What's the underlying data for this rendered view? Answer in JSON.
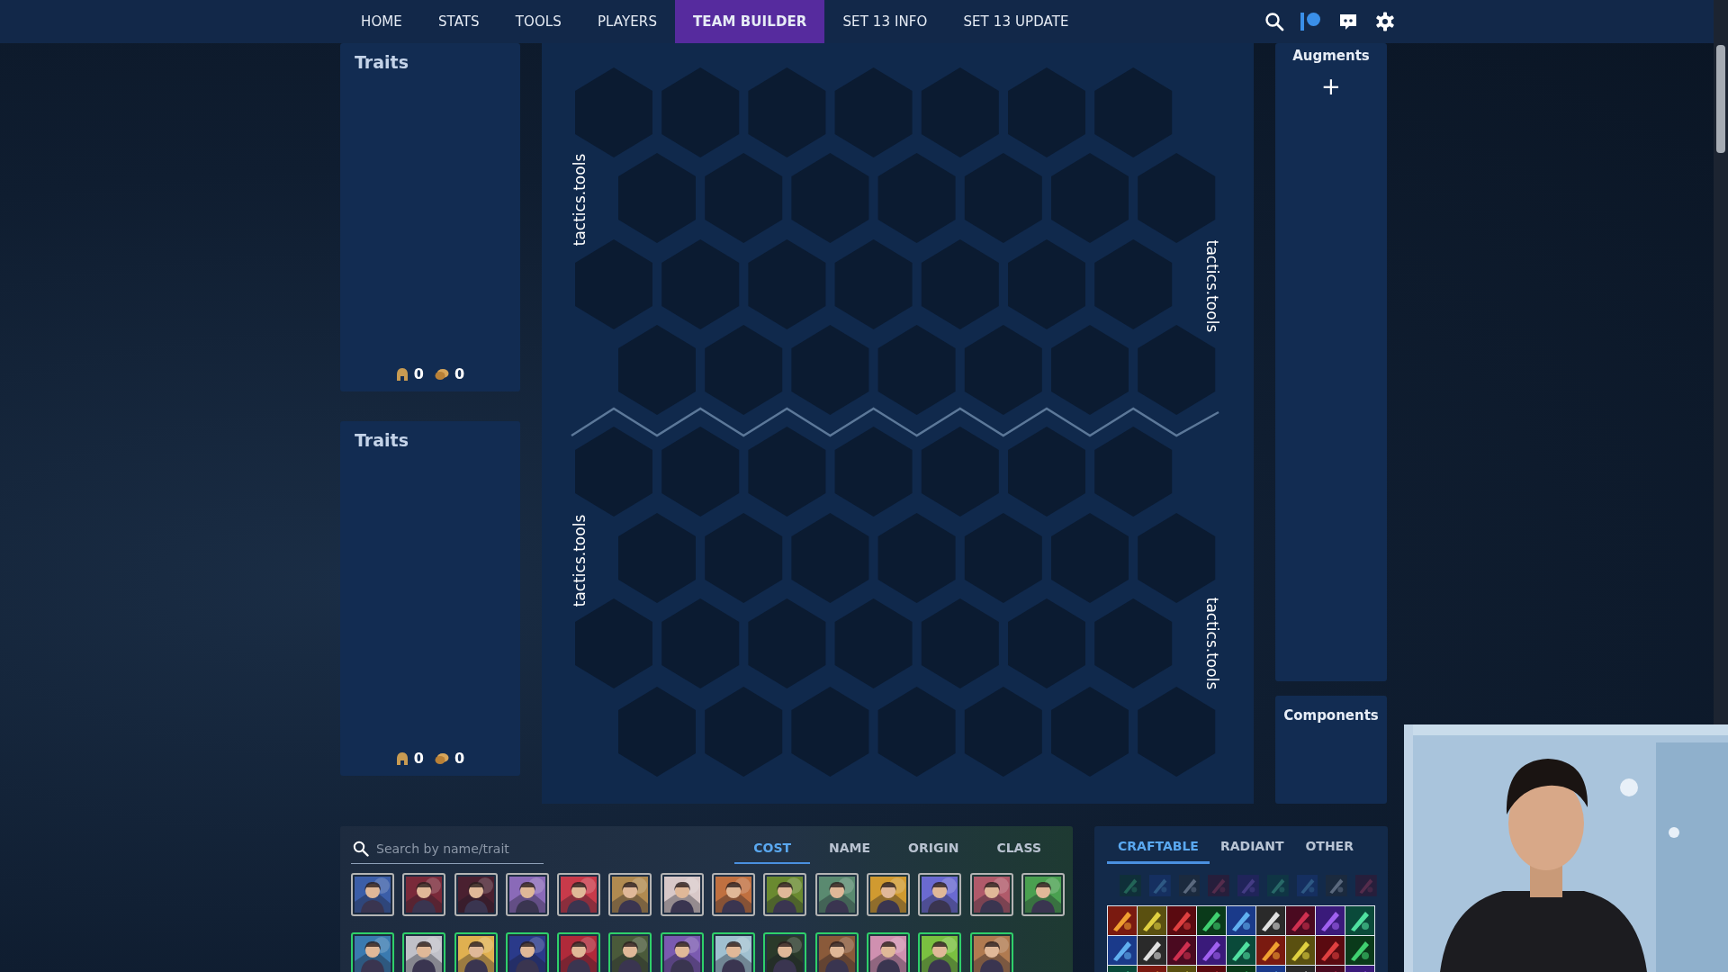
{
  "nav": {
    "items": [
      {
        "label": "HOME",
        "selected": false
      },
      {
        "label": "STATS",
        "selected": false
      },
      {
        "label": "TOOLS",
        "selected": false
      },
      {
        "label": "PLAYERS",
        "selected": false
      },
      {
        "label": "TEAM BUILDER",
        "selected": true
      },
      {
        "label": "SET 13 INFO",
        "selected": false
      },
      {
        "label": "SET 13 UPDATE",
        "selected": false
      }
    ]
  },
  "trait_panels": [
    {
      "title": "Traits",
      "counts": [
        "0",
        "0"
      ]
    },
    {
      "title": "Traits",
      "counts": [
        "0",
        "0"
      ]
    }
  ],
  "board": {
    "labels": [
      "tactics.tools",
      "tactics.tools",
      "tactics.tools",
      "tactics.tools"
    ]
  },
  "augments": {
    "title": "Augments",
    "add_label": "+"
  },
  "components": {
    "title": "Components"
  },
  "champion_picker": {
    "search": {
      "placeholder": "Search by name/trait"
    },
    "sort_tabs": [
      {
        "label": "COST",
        "selected": true
      },
      {
        "label": "NAME",
        "selected": false
      },
      {
        "label": "ORIGIN",
        "selected": false
      },
      {
        "label": "CLASS",
        "selected": false
      }
    ],
    "champions": [
      {
        "color": "#b4b4b4"
      },
      {
        "color": "#b4b4b4"
      },
      {
        "color": "#b4b4b4"
      },
      {
        "color": "#b4b4b4"
      },
      {
        "color": "#b4b4b4"
      },
      {
        "color": "#b4b4b4"
      },
      {
        "color": "#b4b4b4"
      },
      {
        "color": "#b4b4b4"
      },
      {
        "color": "#b4b4b4"
      },
      {
        "color": "#b4b4b4"
      },
      {
        "color": "#b4b4b4"
      },
      {
        "color": "#b4b4b4"
      },
      {
        "color": "#b4b4b4"
      },
      {
        "color": "#b4b4b4"
      },
      {
        "color": "#2fd06a"
      },
      {
        "color": "#2fd06a"
      },
      {
        "color": "#2fd06a"
      },
      {
        "color": "#2fd06a"
      },
      {
        "color": "#2fd06a"
      },
      {
        "color": "#2fd06a"
      },
      {
        "color": "#2fd06a"
      },
      {
        "color": "#2fd06a"
      },
      {
        "color": "#2fd06a"
      },
      {
        "color": "#2fd06a"
      },
      {
        "color": "#2fd06a"
      },
      {
        "color": "#2fd06a"
      },
      {
        "color": "#2fd06a"
      }
    ]
  },
  "item_picker": {
    "tabs": [
      {
        "label": "CRAFTABLE",
        "selected": true
      },
      {
        "label": "RADIANT",
        "selected": false
      },
      {
        "label": "OTHER",
        "selected": false
      }
    ]
  }
}
